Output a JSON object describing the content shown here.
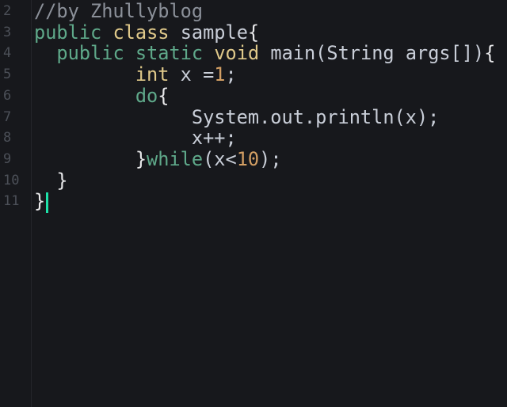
{
  "editor": {
    "line_numbers": [
      "2",
      "3",
      "4",
      "5",
      "6",
      "7",
      "8",
      "9",
      "10",
      "11"
    ],
    "lines": [
      [
        {
          "t": "//by Zhullyblog",
          "c": "cm"
        }
      ],
      [
        {
          "t": "public",
          "c": "kw"
        },
        {
          "t": " ",
          "c": "pu"
        },
        {
          "t": "class",
          "c": "ty"
        },
        {
          "t": " sample",
          "c": "id"
        },
        {
          "t": "{",
          "c": "pu"
        }
      ],
      [
        {
          "t": "  ",
          "c": "pu"
        },
        {
          "t": "public",
          "c": "kw"
        },
        {
          "t": " ",
          "c": "pu"
        },
        {
          "t": "static",
          "c": "kw"
        },
        {
          "t": " ",
          "c": "pu"
        },
        {
          "t": "void",
          "c": "ty"
        },
        {
          "t": " main(String args[])",
          "c": "id"
        },
        {
          "t": "{",
          "c": "pu"
        }
      ],
      [
        {
          "t": "         ",
          "c": "pu"
        },
        {
          "t": "int",
          "c": "ty"
        },
        {
          "t": " x =",
          "c": "id"
        },
        {
          "t": "1",
          "c": "nu"
        },
        {
          "t": ";",
          "c": "id"
        }
      ],
      [
        {
          "t": "         ",
          "c": "pu"
        },
        {
          "t": "do",
          "c": "kw"
        },
        {
          "t": "{",
          "c": "pu"
        }
      ],
      [
        {
          "t": "              System.out.println(x);",
          "c": "id"
        }
      ],
      [
        {
          "t": "              x++;",
          "c": "id"
        }
      ],
      [
        {
          "t": "         }",
          "c": "pu"
        },
        {
          "t": "while",
          "c": "kw"
        },
        {
          "t": "(x<",
          "c": "id"
        },
        {
          "t": "10",
          "c": "nu"
        },
        {
          "t": ");",
          "c": "id"
        }
      ],
      [
        {
          "t": "  }",
          "c": "pu"
        }
      ],
      [
        {
          "t": "}",
          "c": "pu"
        }
      ]
    ],
    "cursor_line": 11,
    "colors": {
      "background": "#17181c",
      "keyword": "#5fa98a",
      "type": "#e0c98a",
      "comment": "#8b9099",
      "number": "#d39f64",
      "cursor": "#1de0a8"
    }
  }
}
